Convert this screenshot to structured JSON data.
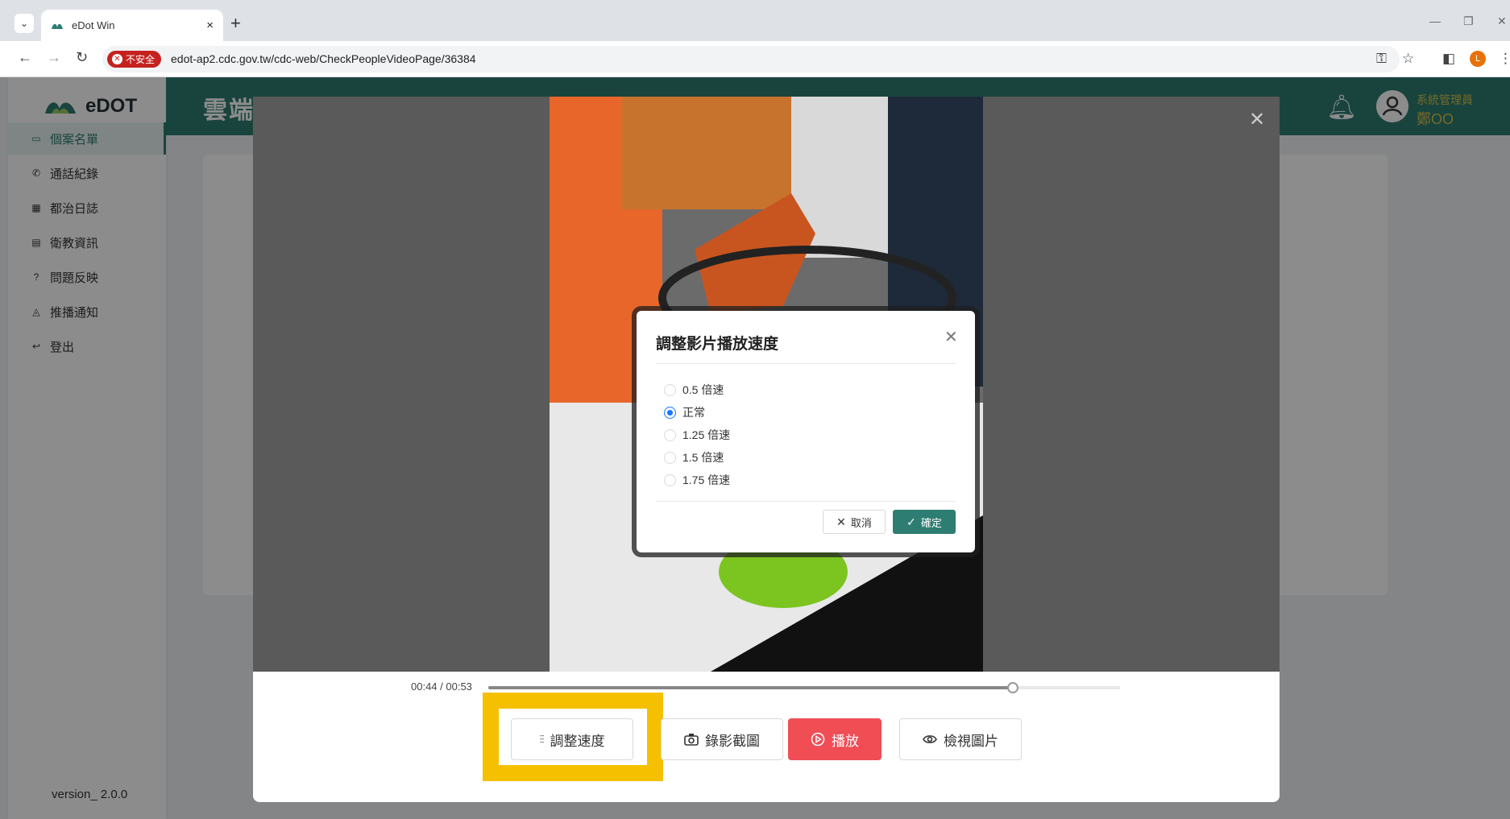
{
  "browser": {
    "tab_title": "eDot Win",
    "tab_close": "×",
    "new_tab": "+",
    "security_label": "不安全",
    "url": "edot-ap2.cdc.gov.tw/cdc-web/CheckPeopleVideoPage/36384",
    "profile_initial": "L"
  },
  "app": {
    "logo_text": "eDOT",
    "header_title": "雲端",
    "user_role": "系統管理員",
    "user_name": "鄭OO",
    "version": "version_ 2.0.0",
    "sidebar_items": [
      {
        "label": "個案名單",
        "icon": "id-card-icon",
        "active": true
      },
      {
        "label": "通話紀錄",
        "icon": "phone-icon",
        "active": false
      },
      {
        "label": "都治日誌",
        "icon": "grid-icon",
        "active": false
      },
      {
        "label": "衛教資訊",
        "icon": "book-icon",
        "active": false
      },
      {
        "label": "問題反映",
        "icon": "question-icon",
        "active": false
      },
      {
        "label": "推播通知",
        "icon": "bell-icon",
        "active": false
      },
      {
        "label": "登出",
        "icon": "logout-icon",
        "active": false
      }
    ]
  },
  "player": {
    "time": "00:44 / 00:53",
    "progress": 0.83,
    "buttons": {
      "speed": "調整速度",
      "screenshot": "錄影截圖",
      "play": "播放",
      "view_images": "檢視圖片"
    }
  },
  "speed_dialog": {
    "title": "調整影片播放速度",
    "options": [
      "0.5 倍速",
      "正常",
      "1.25 倍速",
      "1.5 倍速",
      "1.75 倍速"
    ],
    "selected_index": 1,
    "cancel_label": "取消",
    "ok_label": "確定"
  },
  "colors": {
    "brand": "#2e7d72",
    "play": "#f04d55",
    "highlight": "#f5c000",
    "radio": "#1677ff"
  }
}
